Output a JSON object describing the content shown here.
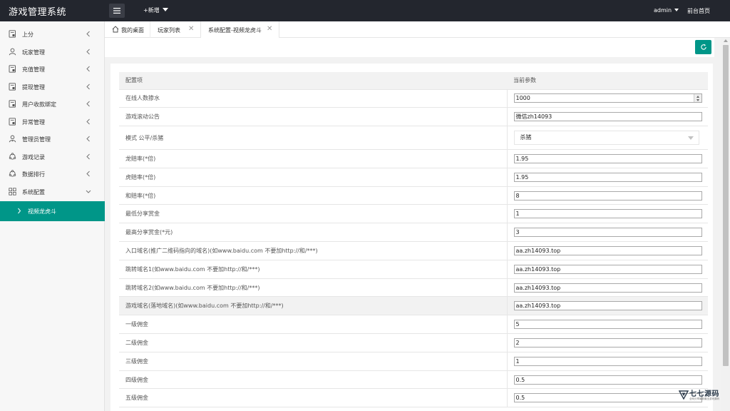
{
  "app": {
    "title": "游戏管理系统",
    "add_new": "+新增",
    "user": "admin",
    "front_page": "前台首页"
  },
  "sidebar": {
    "items": [
      {
        "label": "上分",
        "icon": "document-icon"
      },
      {
        "label": "玩家管理",
        "icon": "user-icon"
      },
      {
        "label": "充值管理",
        "icon": "document-icon"
      },
      {
        "label": "提现管理",
        "icon": "document-icon"
      },
      {
        "label": "用户收款绑定",
        "icon": "document-icon"
      },
      {
        "label": "异常管理",
        "icon": "document-icon"
      },
      {
        "label": "管理员管理",
        "icon": "admin-user-icon"
      },
      {
        "label": "游戏记录",
        "icon": "cycle-icon"
      },
      {
        "label": "数据排行",
        "icon": "cycle-icon"
      },
      {
        "label": "系统配置",
        "icon": "grid-icon"
      }
    ],
    "active_sub": "视频龙虎斗"
  },
  "tabs": [
    {
      "label": "我的桌面",
      "icon": "home-icon"
    },
    {
      "label": "玩家列表"
    },
    {
      "label": "系统配置-视频龙虎斗",
      "active": true
    }
  ],
  "table": {
    "headers": [
      "配置项",
      "当前参数"
    ],
    "rows": [
      {
        "label": "在线人数掺水",
        "value": "1000",
        "type": "number"
      },
      {
        "label": "游戏滚动公告",
        "value": "微信zh14093",
        "type": "text"
      },
      {
        "label": "模式 公平/杀猪",
        "value": "杀猪",
        "type": "select"
      },
      {
        "label": "龙赔率(*倍)",
        "value": "1.95",
        "type": "text"
      },
      {
        "label": "虎赔率(*倍)",
        "value": "1.95",
        "type": "text"
      },
      {
        "label": "和赔率(*倍)",
        "value": "8",
        "type": "text"
      },
      {
        "label": "最低分享赏金",
        "value": "1",
        "type": "text"
      },
      {
        "label": "最高分享赏金(*元)",
        "value": "3",
        "type": "text"
      },
      {
        "label": "入口域名(推广二维码指向的域名)(如www.baidu.com 不要加http://和/***)",
        "value": "aa.zh14093.top",
        "type": "text"
      },
      {
        "label": "跳转域名1(如www.baidu.com 不要加http://和/***)",
        "value": "aa.zh14093.top",
        "type": "text"
      },
      {
        "label": "跳转域名2(如www.baidu.com 不要加http://和/***)",
        "value": "aa.zh14093.top",
        "type": "text"
      },
      {
        "label": "游戏域名(落地域名)(如www.baidu.com 不要加http://和/***)",
        "value": "aa.zh14093.top",
        "type": "text",
        "highlight": true
      },
      {
        "label": "一级佣金",
        "value": "5",
        "type": "text"
      },
      {
        "label": "二级佣金",
        "value": "2",
        "type": "text"
      },
      {
        "label": "三级佣金",
        "value": "1",
        "type": "text"
      },
      {
        "label": "四级佣金",
        "value": "0.5",
        "type": "text"
      },
      {
        "label": "五级佣金",
        "value": "0.5",
        "type": "text"
      }
    ]
  },
  "watermark": {
    "name": "七七源码",
    "subtitle": "全网分享最新最全游戏源码"
  },
  "colors": {
    "topbar": "#23262e",
    "accent": "#009688"
  }
}
